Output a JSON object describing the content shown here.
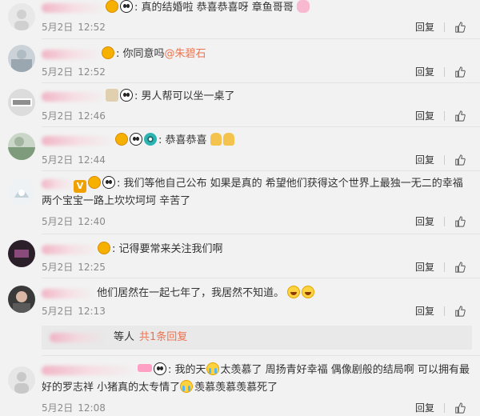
{
  "actions": {
    "reply_label": "回复"
  },
  "comments": [
    {
      "text": "真的结婚啦 恭喜恭喜呀 章鱼哥哥",
      "date": "5月2日",
      "time": "12:52"
    },
    {
      "text": "你同意吗",
      "mention": "@朱碧石",
      "date": "5月2日",
      "time": "12:52"
    },
    {
      "text": "男人帮可以坐一桌了",
      "date": "5月2日",
      "time": "12:46"
    },
    {
      "text": "恭喜恭喜",
      "date": "5月2日",
      "time": "12:44"
    },
    {
      "text": "我们等他自己公布 如果是真的 希望他们获得这个世界上最独一无二的幸福 两个宝宝一路上坎坎坷坷 辛苦了",
      "date": "5月2日",
      "time": "12:40"
    },
    {
      "text": "记得要常来关注我们啊",
      "date": "5月2日",
      "time": "12:25"
    },
    {
      "text": "他们居然在一起七年了，我居然不知道。",
      "date": "5月2日",
      "time": "12:13",
      "replies": {
        "who": "等人",
        "count": "共1条回复"
      }
    },
    {
      "text_a": "我的天",
      "text_b": "太羡慕了 周扬青好幸福 偶像剧般的结局啊 可以拥有最好的罗志祥 小猪真的太专情了",
      "text_c": "羡慕羡慕羡慕死了",
      "date": "5月2日",
      "time": "12:08"
    }
  ],
  "icons": {
    "avatar": "user-avatar",
    "emoji_panda": "panda-emoji-icon",
    "emoji_medal": "medal-badge-icon",
    "emoji_vip": "vip-badge-icon",
    "like": "thumbs-up-icon"
  },
  "colors": {
    "mention": "#eb7350",
    "meta": "#8a8a8a",
    "background": "#f2f2f2"
  }
}
